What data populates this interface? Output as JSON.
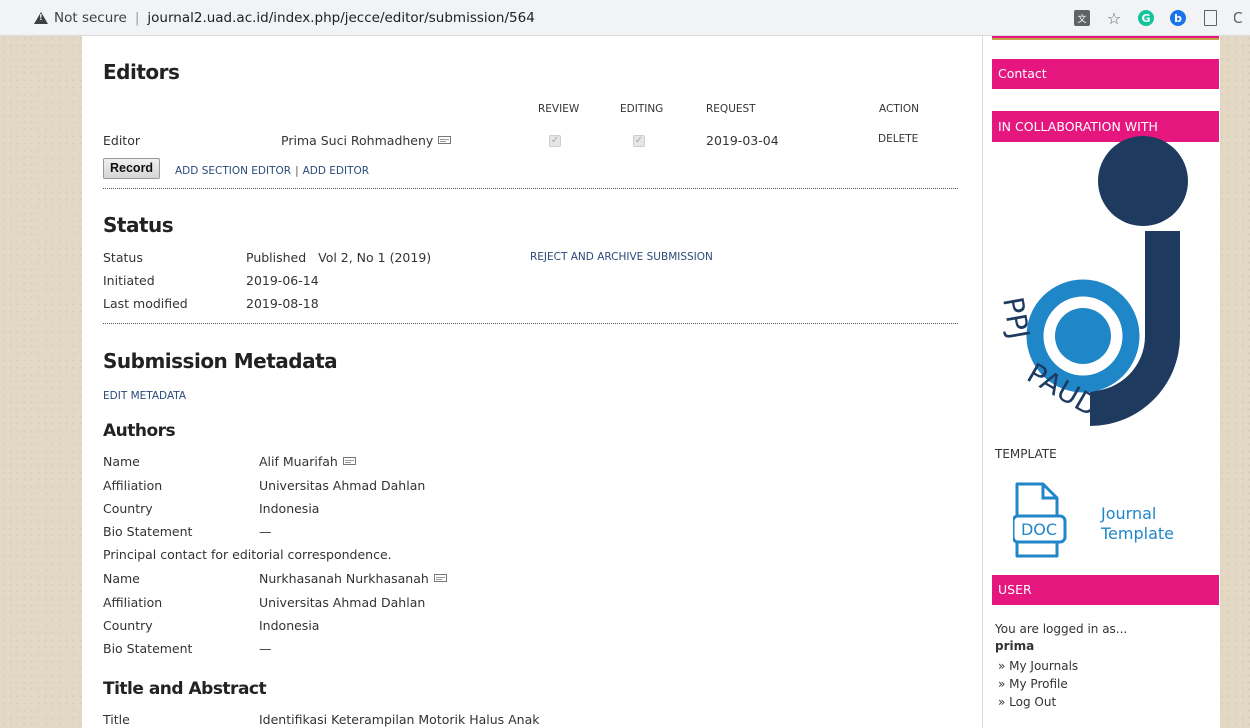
{
  "browser": {
    "not_secure": "Not secure",
    "url": "journal2.uad.ac.id/index.php/jecce/editor/submission/564"
  },
  "editors": {
    "heading": "Editors",
    "columns": {
      "review": "REVIEW",
      "editing": "EDITING",
      "request": "REQUEST",
      "action": "ACTION"
    },
    "row": {
      "role": "Editor",
      "name": "Prima Suci Rohmadheny",
      "request": "2019-03-04",
      "action": "DELETE"
    },
    "record_button": "Record",
    "add_section_editor": "ADD SECTION EDITOR",
    "link_sep": "|",
    "add_editor": "ADD EDITOR"
  },
  "status": {
    "heading": "Status",
    "status_label": "Status",
    "status_value": "Published",
    "issue": "Vol 2, No 1 (2019)",
    "reject_link": "REJECT AND ARCHIVE SUBMISSION",
    "initiated_label": "Initiated",
    "initiated_value": "2019-06-14",
    "modified_label": "Last modified",
    "modified_value": "2019-08-18"
  },
  "metadata": {
    "heading": "Submission Metadata",
    "edit_link": "EDIT METADATA",
    "authors_heading": "Authors",
    "author1": {
      "name_label": "Name",
      "name": "Alif Muarifah",
      "affiliation_label": "Affiliation",
      "affiliation": "Universitas Ahmad Dahlan",
      "country_label": "Country",
      "country": "Indonesia",
      "bio_label": "Bio Statement",
      "bio": "—"
    },
    "principal_note": "Principal contact for editorial correspondence.",
    "author2": {
      "name_label": "Name",
      "name": "Nurkhasanah Nurkhasanah",
      "affiliation_label": "Affiliation",
      "affiliation": "Universitas Ahmad Dahlan",
      "country_label": "Country",
      "country": "Indonesia",
      "bio_label": "Bio Statement",
      "bio": "—"
    },
    "title_abstract_heading": "Title and Abstract",
    "title_label": "Title",
    "title_value": "Identifikasi Keterampilan Motorik Halus Anak"
  },
  "sidebar": {
    "contact": "Contact",
    "collab_heading": "IN COLLABORATION WITH",
    "logo_text": "PPJ PAUD",
    "template_heading": "TEMPLATE",
    "doc_label": "DOC",
    "journal_word": "Journal",
    "template_word": "Template",
    "user_heading": "USER",
    "logged_in": "You are logged in as...",
    "username": "prima",
    "links": [
      "» My Journals",
      "» My Profile",
      "» Log Out"
    ]
  },
  "colors": {
    "accent": "#e5177e",
    "logo_dark": "#1e3a5f",
    "logo_blue": "#1f86c8",
    "link": "#2a4a7a"
  }
}
